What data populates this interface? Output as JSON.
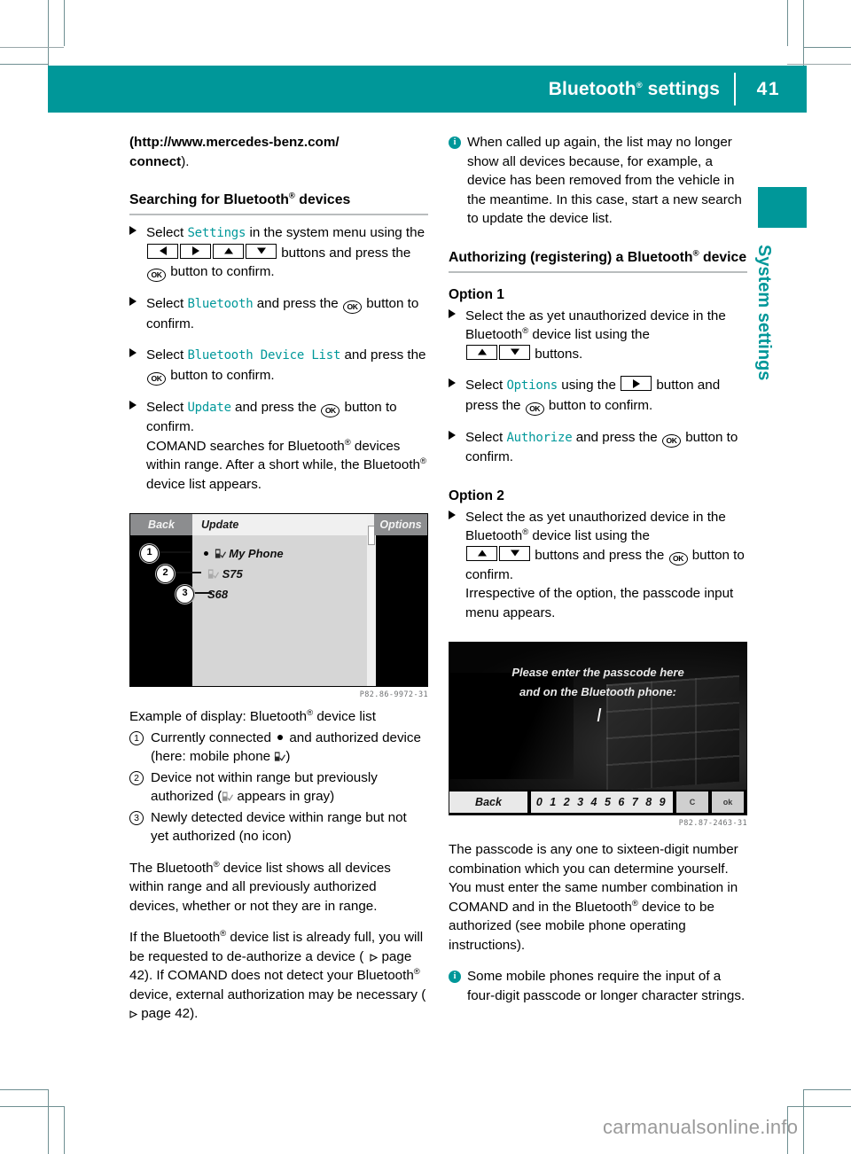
{
  "header": {
    "title_main": "Bluetooth",
    "title_reg": "®",
    "title_tail": " settings",
    "page_number": "41",
    "accent_color": "#009799"
  },
  "side_tab": {
    "label": "System settings"
  },
  "left_column": {
    "intro_url": "(http://www.mercedes-benz.com/",
    "intro_url2": "connect",
    "intro_tail": ").",
    "section_heading": "Searching for Bluetooth",
    "section_heading_tail": " devices",
    "steps": [
      {
        "a": "Select ",
        "mono": "Settings",
        "b": " in the system menu using the ",
        "keys": [
          "left",
          "right",
          "up",
          "down"
        ],
        "c": " buttons and press the ",
        "ok": "OK",
        "d": " button to confirm."
      },
      {
        "a": "Select ",
        "mono": "Bluetooth",
        "b": " and press the ",
        "ok": "OK",
        "c": " button to confirm."
      },
      {
        "a": "Select ",
        "mono": "Bluetooth Device List",
        "b": " and press the ",
        "ok": "OK",
        "c": " button to confirm."
      },
      {
        "a": "Select ",
        "mono": "Update",
        "b": " and press the ",
        "ok": "OK",
        "c": " button to confirm.",
        "extra1": "COMAND searches for Bluetooth",
        "extra1_tail": " devices within range. After a short while, the Bluetooth",
        "extra1_tail2": " device list appears."
      }
    ],
    "figure1": {
      "back_label": "Back",
      "update_label": "Update",
      "options_label": "Options",
      "rows": [
        "My Phone",
        "S75",
        "S68"
      ],
      "callouts": [
        "1",
        "2",
        "3"
      ],
      "code": "P82.86-9972-31"
    },
    "figure1_caption": "Example of display: Bluetooth",
    "figure1_caption_tail": " device list",
    "callout_items": [
      {
        "num": "1",
        "a": "Currently connected ",
        "b": " and authorized device (here: mobile phone ",
        "c": ")"
      },
      {
        "num": "2",
        "a": "Device not within range but previously authorized (",
        "b": " appears in gray)"
      },
      {
        "num": "3",
        "a": "Newly detected device within range but not yet authorized (no icon)"
      }
    ],
    "para1_a": "The Bluetooth",
    "para1_b": " device list shows all devices within range and all previously authorized devices, whether or not they are in range.",
    "para2_a": "If the Bluetooth",
    "para2_b": " device list is already full, you will be requested to de-authorize a device (",
    "para2_c": " page 42). If COMAND does not detect your Bluetooth",
    "para2_d": " device, external authorization may be necessary (",
    "para2_e": " page 42)."
  },
  "right_column": {
    "info1": "When called up again, the list may no longer show all devices because, for example, a device has been removed from the vehicle in the meantime. In this case, start a new search to update the device list.",
    "section_heading": "Authorizing (registering) a Bluetooth",
    "section_heading_tail": " device",
    "option1_heading": "Option 1",
    "option1_steps": [
      {
        "a": "Select the as yet unauthorized device in the Bluetooth",
        "b": " device list using the ",
        "keys": [
          "up",
          "down"
        ],
        "c": " buttons."
      },
      {
        "a": "Select ",
        "mono": "Options",
        "b": " using the ",
        "keys": [
          "right"
        ],
        "c": " button and press the ",
        "ok": "OK",
        "d": " button to confirm."
      },
      {
        "a": "Select ",
        "mono": "Authorize",
        "b": " and press the ",
        "ok": "OK",
        "c": " button to confirm."
      }
    ],
    "option2_heading": "Option 2",
    "option2_steps": [
      {
        "a": "Select the as yet unauthorized device in the Bluetooth",
        "b": " device list using the ",
        "keys": [
          "up",
          "down"
        ],
        "c": " buttons and press the ",
        "ok": "OK",
        "d": " button to confirm.",
        "extra": "Irrespective of the option, the passcode input menu appears."
      }
    ],
    "figure2": {
      "prompt_line1": "Please enter the passcode here",
      "prompt_line2": "and on the Bluetooth phone:",
      "back_label": "Back",
      "digits": "0 1 2 3 4 5 6 7 8 9",
      "delete_label": "C",
      "ok_label": "ok",
      "code": "P82.87-2463-31"
    },
    "para1_a": "The passcode is any one to sixteen-digit number combination which you can determine yourself. You must enter the same number combination in COMAND and in the Bluetooth",
    "para1_b": " device to be authorized (see mobile phone operating instructions).",
    "info2": "Some mobile phones require the input of a four-digit passcode or longer character strings."
  },
  "watermark": "carmanualsonline.info"
}
